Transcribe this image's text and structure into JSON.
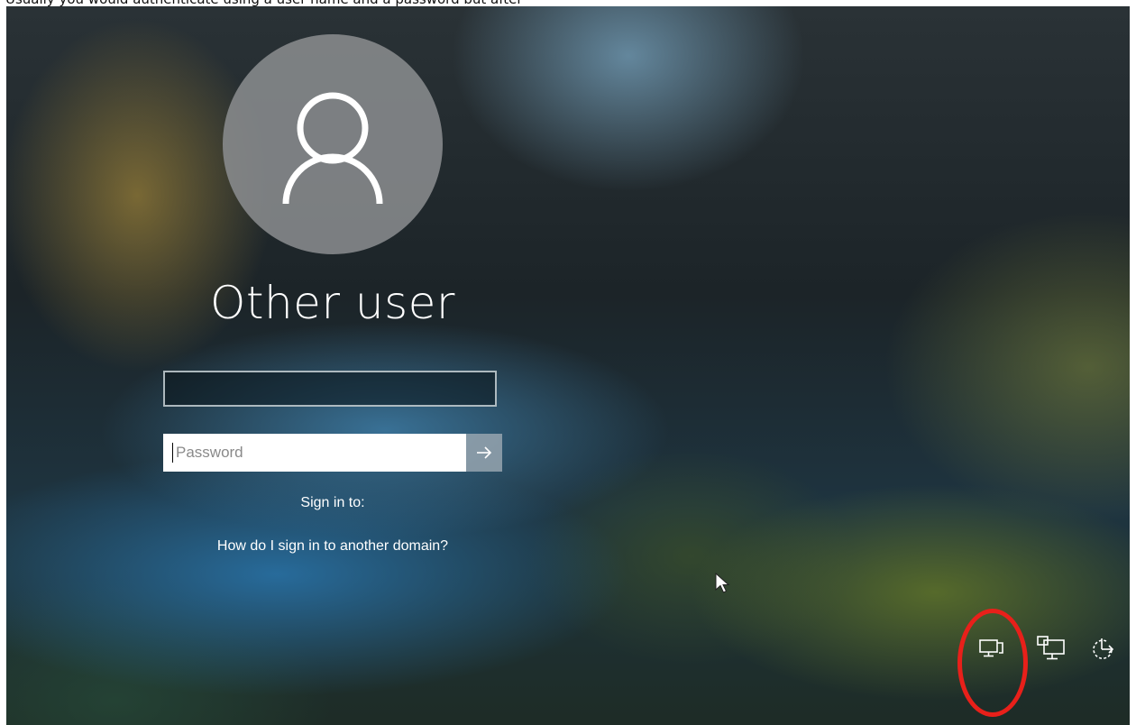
{
  "caption": "Usually you would authenticate using a user name and a password but after",
  "login": {
    "user_name": "Other user",
    "username_value": "",
    "password_placeholder": "Password",
    "sign_in_to": "Sign in to:",
    "other_domain_link": "How do I sign in to another domain?"
  },
  "system_icons": [
    "network-icon",
    "accessibility-icon",
    "power-icon"
  ],
  "colors": {
    "highlight": "#e8201a",
    "submit_button": "#96a5af"
  }
}
